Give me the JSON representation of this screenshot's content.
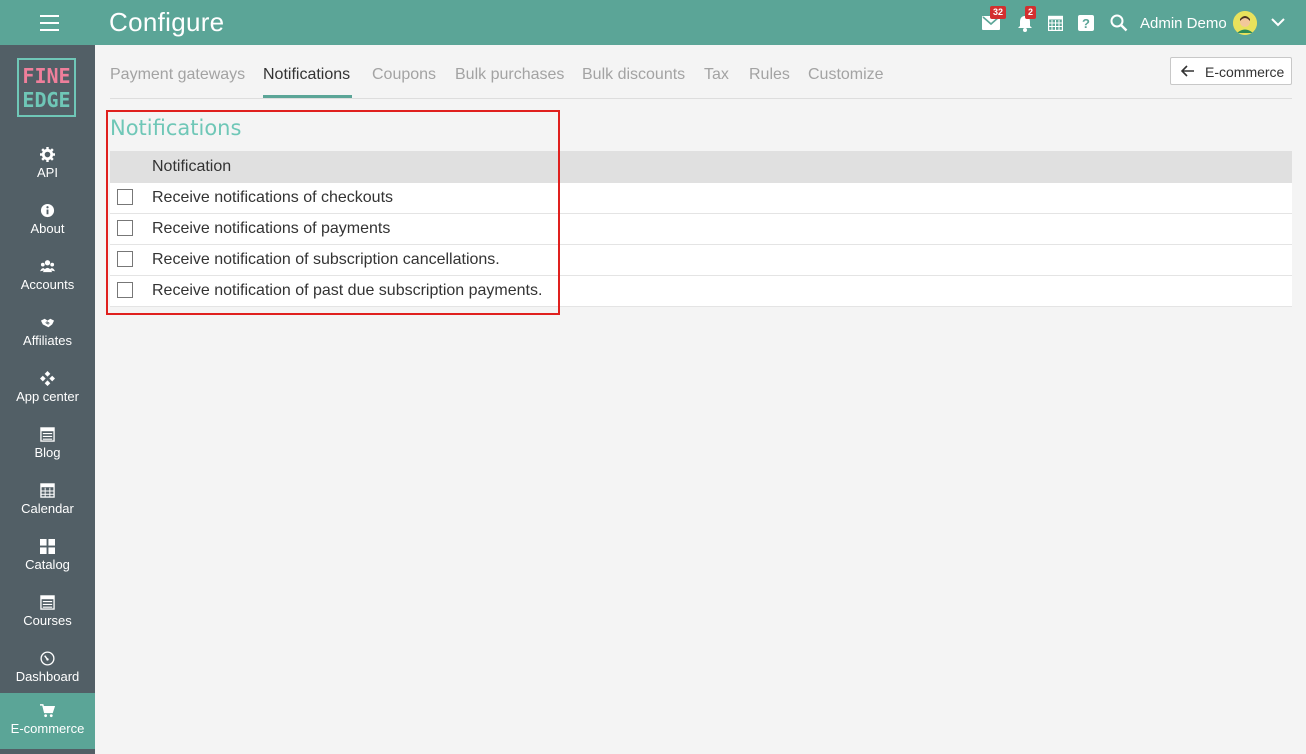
{
  "header": {
    "title": "Configure",
    "mail_badge": "32",
    "notifications_badge": "2",
    "user_name": "Admin Demo"
  },
  "sidebar": {
    "logo_line1": "FINE",
    "logo_line2": "EDGE",
    "items": [
      {
        "label": "API",
        "icon": "gear-icon"
      },
      {
        "label": "About",
        "icon": "info-icon"
      },
      {
        "label": "Accounts",
        "icon": "users-icon"
      },
      {
        "label": "Affiliates",
        "icon": "handshake-icon"
      },
      {
        "label": "App center",
        "icon": "apps-icon"
      },
      {
        "label": "Blog",
        "icon": "calendar-list-icon"
      },
      {
        "label": "Calendar",
        "icon": "calendar-grid-icon"
      },
      {
        "label": "Catalog",
        "icon": "grid-icon"
      },
      {
        "label": "Courses",
        "icon": "calendar-list-icon"
      },
      {
        "label": "Dashboard",
        "icon": "gauge-icon"
      },
      {
        "label": "E-commerce",
        "icon": "cart-icon",
        "active": true
      }
    ]
  },
  "tabs": [
    {
      "label": "Payment gateways"
    },
    {
      "label": "Notifications",
      "active": true
    },
    {
      "label": "Coupons"
    },
    {
      "label": "Bulk purchases"
    },
    {
      "label": "Bulk discounts"
    },
    {
      "label": "Tax"
    },
    {
      "label": "Rules"
    },
    {
      "label": "Customize"
    }
  ],
  "back_button": {
    "label": "E-commerce"
  },
  "section": {
    "title": "Notifications",
    "column_header": "Notification",
    "rows": [
      {
        "label": "Receive notifications of checkouts",
        "checked": false
      },
      {
        "label": "Receive notifications of payments",
        "checked": false
      },
      {
        "label": "Receive notification of subscription cancellations.",
        "checked": false
      },
      {
        "label": "Receive notification of past due subscription payments.",
        "checked": false
      }
    ]
  },
  "colors": {
    "header_bg": "#5ba597",
    "sidebar_bg": "#525f66",
    "accent": "#6fc7b7",
    "highlight": "#e0201e"
  }
}
